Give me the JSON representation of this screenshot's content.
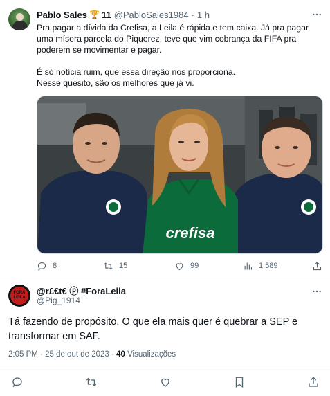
{
  "tweet": {
    "author_name": "Pablo Sales",
    "author_emoji": "🏆",
    "author_badge_number": "11",
    "author_handle": "@PabloSales1984",
    "separator": "·",
    "time_ago": "1 h",
    "text_lines": [
      "Pra pagar a dívida da Crefisa, a Leila é rápida e tem caixa. Já pra pagar uma mísera parcela do Piquerez, teve que vim cobrança da FIFA pra poderem se movimentar e pagar.",
      "É só notícia ruim, que essa direção nos proporciona.",
      "Nesse quesito, são os melhores que já vi."
    ],
    "photo_shirt_text": "crefisa",
    "stats": {
      "replies": "8",
      "retweets": "15",
      "likes": "99",
      "views": "1.589"
    }
  },
  "reply": {
    "author_name": "@r£€t€ ⓟ #ForaLeila",
    "author_handle": "@Pig_1914",
    "avatar_text": "FORA LEILA",
    "text": "Tá fazendo de propósito. O que ela mais quer é quebrar a SEP e transformar em SAF.",
    "time": "2:05 PM",
    "separator": "·",
    "date": "25 de out de 2023",
    "views_count": "40",
    "views_label": "Visualizações"
  },
  "colors": {
    "text_primary": "#0f1419",
    "text_secondary": "#536471",
    "divider": "#eff3f4",
    "palmeiras_green": "#0c6b3a",
    "navy": "#1c2a4a"
  },
  "icons": {
    "more": "more-icon",
    "reply": "reply-icon",
    "retweet": "retweet-icon",
    "like": "like-icon",
    "views": "views-icon",
    "share": "share-icon",
    "bookmark": "bookmark-icon"
  }
}
